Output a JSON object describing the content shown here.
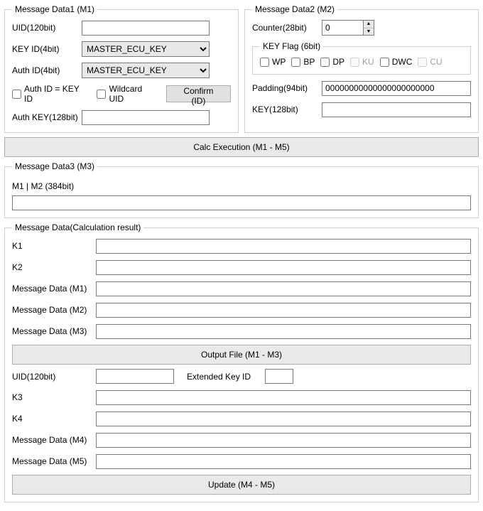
{
  "m1": {
    "legend": "Message Data1 (M1)",
    "uid_label": "UID(120bit)",
    "uid_value": "",
    "keyid_label": "KEY ID(4bit)",
    "keyid_value": "MASTER_ECU_KEY",
    "authid_label": "Auth ID(4bit)",
    "authid_value": "MASTER_ECU_KEY",
    "cb_authid_keyid": "Auth ID = KEY ID",
    "cb_wildcard": "Wildcard UID",
    "confirm_btn": "Confirm (ID)",
    "authkey_label": "Auth KEY(128bit)",
    "authkey_value": ""
  },
  "m2": {
    "legend": "Message Data2 (M2)",
    "counter_label": "Counter(28bit)",
    "counter_value": "0",
    "keyflag_legend": "KEY Flag (6bit)",
    "flags": {
      "wp": "WP",
      "bp": "BP",
      "dp": "DP",
      "ku": "KU",
      "dwc": "DWC",
      "cu": "CU"
    },
    "padding_label": "Padding(94bit)",
    "padding_value": "00000000000000000000000",
    "key_label": "KEY(128bit)",
    "key_value": ""
  },
  "calc_btn": "Calc Execution (M1 - M5)",
  "m3": {
    "legend": "Message Data3 (M3)",
    "m1m2_label": "M1 | M2 (384bit)",
    "m1m2_value": ""
  },
  "calc": {
    "legend": "Message Data(Calculation result)",
    "k1_label": "K1",
    "k1_value": "",
    "k2_label": "K2",
    "k2_value": "",
    "md1_label": "Message Data (M1)",
    "md1_value": "",
    "md2_label": "Message Data (M2)",
    "md2_value": "",
    "md3_label": "Message Data (M3)",
    "md3_value": "",
    "output_btn": "Output File (M1 - M3)",
    "uid_label": "UID(120bit)",
    "uid_value": "",
    "ext_label": "Extended Key ID",
    "ext_value": "",
    "k3_label": "K3",
    "k3_value": "",
    "k4_label": "K4",
    "k4_value": "",
    "md4_label": "Message Data (M4)",
    "md4_value": "",
    "md5_label": "Message Data (M5)",
    "md5_value": "",
    "update_btn": "Update (M4 - M5)"
  }
}
